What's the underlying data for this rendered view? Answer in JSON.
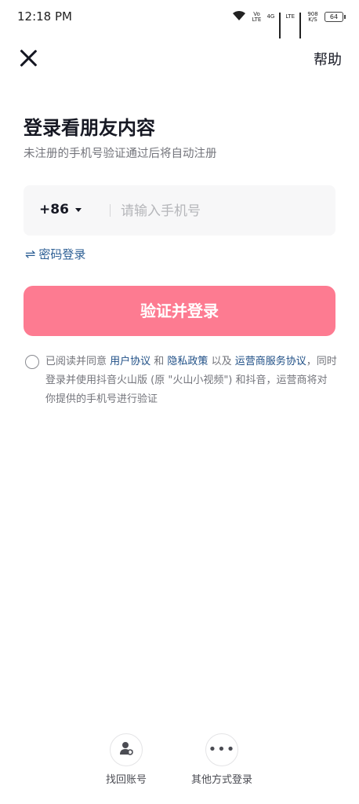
{
  "status_bar": {
    "time": "12:18 PM",
    "volte": "Vo LTE",
    "network_4g": "4G",
    "network_lte": "LTE",
    "speed_value": "908",
    "speed_unit": "K/S",
    "battery": "64"
  },
  "header": {
    "help_label": "帮助"
  },
  "title": "登录看朋友内容",
  "subtitle": "未注册的手机号验证通过后将自动注册",
  "phone": {
    "country_code": "+86",
    "placeholder": "请输入手机号",
    "value": ""
  },
  "password_login_label": "密码登录",
  "submit_label": "验证并登录",
  "agreement": {
    "checked": false,
    "part1": "已阅读并同意 ",
    "link_user": "用户协议",
    "part2": " 和 ",
    "link_privacy": "隐私政策",
    "part3": " 以及 ",
    "link_carrier": "运营商服务协议",
    "part4": "，同时登录并使用抖音火山版 (原 \"火山小视频\") 和抖音，运营商将对你提供的手机号进行验证"
  },
  "bottom_options": [
    {
      "label": "找回账号",
      "icon": "user-recover-icon"
    },
    {
      "label": "其他方式登录",
      "icon": "more-dots-icon"
    }
  ],
  "colors": {
    "accent_button": "#fd7b91",
    "link": "#2d5f94"
  }
}
